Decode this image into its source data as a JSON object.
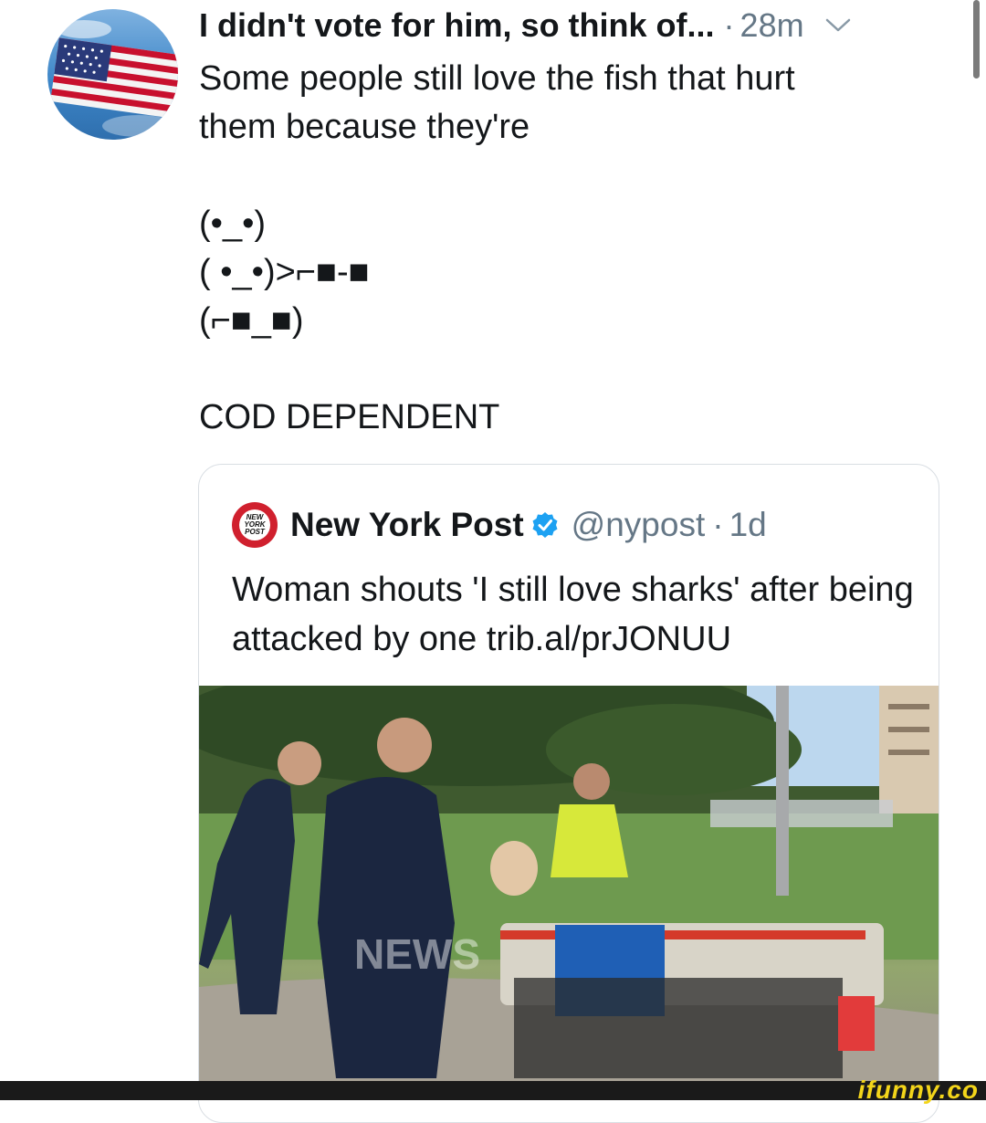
{
  "tweet": {
    "author_name": "I didn't vote for him, so think of...",
    "separator": "·",
    "time": "28m",
    "text": "Some people still love the fish that hurt\nthem because they're\n\n(•_•)\n( •_•)>⌐■-■\n(⌐■_■)\n\nCOD DEPENDENT"
  },
  "quote": {
    "logo_text": [
      "NEW",
      "YORK",
      "POST"
    ],
    "name": "New York Post",
    "handle": "@nypost",
    "separator": "·",
    "time": "1d",
    "text": "Woman shouts 'I still love sharks' after being attacked by one trib.al/prJONUU",
    "media_overlay_text": "NEWS"
  },
  "watermark": "ifunny.co",
  "colors": {
    "verified": "#1da1f2",
    "nyp_logo": "#d0202e",
    "watermark": "#f3d51a"
  },
  "icons": [
    "us-flag-avatar-icon",
    "chevron-down-icon",
    "verified-badge-icon",
    "nypost-logo-icon"
  ]
}
